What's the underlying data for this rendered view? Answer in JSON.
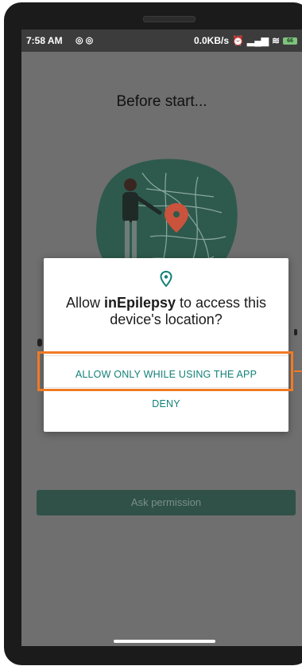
{
  "status_bar": {
    "time": "7:58 AM",
    "network_speed": "0.0KB/s",
    "battery": "66"
  },
  "page": {
    "title": "Before start...",
    "ask_permission_label": "Ask permission"
  },
  "dialog": {
    "prefix": "Allow ",
    "app_name": "inEpilepsy",
    "suffix": " to access this device's location?",
    "allow_label": "ALLOW ONLY WHILE USING THE APP",
    "deny_label": "DENY"
  },
  "colors": {
    "accent": "#138079",
    "button_bg": "#2f5148",
    "highlight": "#f07a26"
  }
}
